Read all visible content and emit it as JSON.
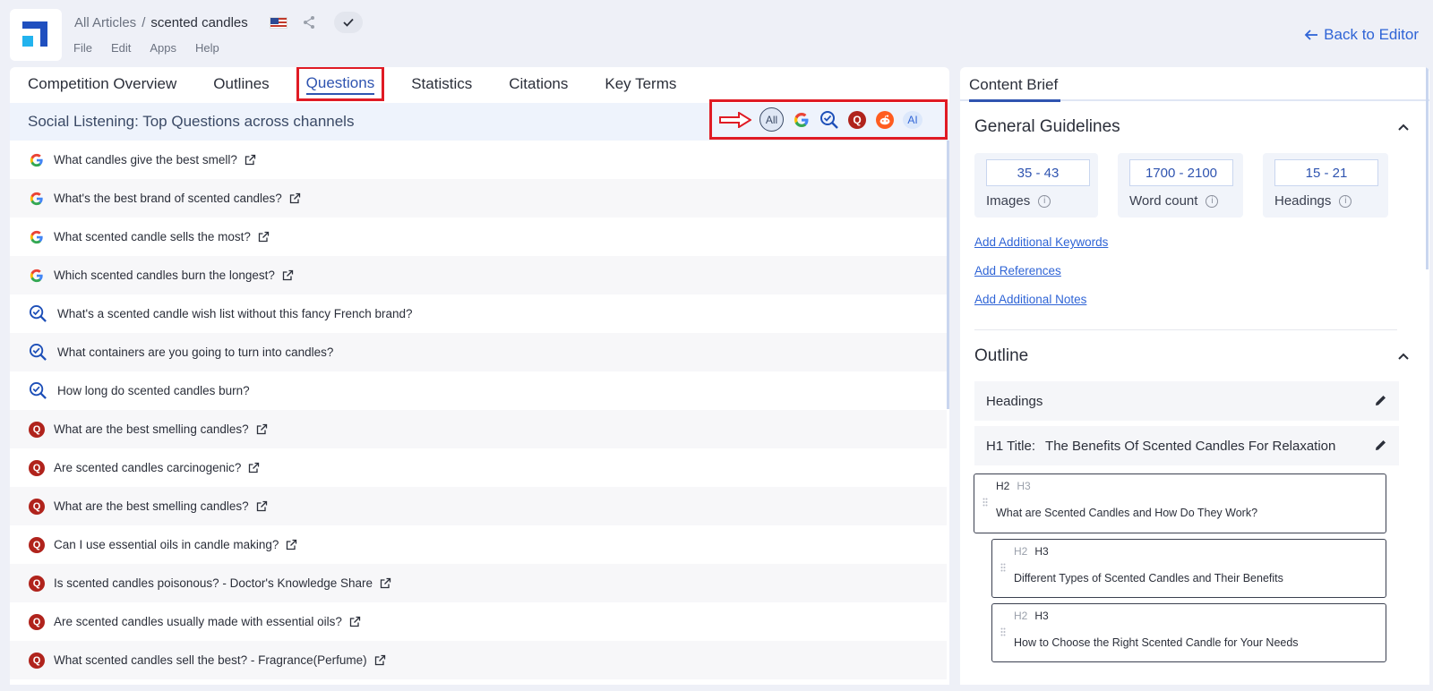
{
  "header": {
    "breadcrumb_root": "All Articles",
    "breadcrumb_sep": "/",
    "breadcrumb_current": "scented candles",
    "menu": [
      "File",
      "Edit",
      "Apps",
      "Help"
    ],
    "back_label": "Back to Editor"
  },
  "tabs": [
    "Competition Overview",
    "Outlines",
    "Questions",
    "Statistics",
    "Citations",
    "Key Terms"
  ],
  "active_tab": "Questions",
  "social": {
    "title": "Social Listening: Top Questions across channels",
    "filter_all": "All",
    "filter_ai": "AI",
    "filter_quora_glyph": "Q"
  },
  "questions": [
    {
      "source": "google",
      "text": "What candles give the best smell?"
    },
    {
      "source": "google",
      "text": "What's the best brand of scented candles?"
    },
    {
      "source": "google",
      "text": "What scented candle sells the most?"
    },
    {
      "source": "google",
      "text": "Which scented candles burn the longest?"
    },
    {
      "source": "search",
      "text": "What's a scented candle wish list without this fancy French brand?"
    },
    {
      "source": "search",
      "text": "What containers are you going to turn into candles?"
    },
    {
      "source": "search",
      "text": "How long do scented candles burn?"
    },
    {
      "source": "quora",
      "text": "What are the best smelling candles?"
    },
    {
      "source": "quora",
      "text": "Are scented candles carcinogenic?"
    },
    {
      "source": "quora",
      "text": "What are the best smelling candles?"
    },
    {
      "source": "quora",
      "text": "Can I use essential oils in candle making?"
    },
    {
      "source": "quora",
      "text": "Is scented candles poisonous? - Doctor's Knowledge Share"
    },
    {
      "source": "quora",
      "text": "Are scented candles usually made with essential oils?"
    },
    {
      "source": "quora",
      "text": "What scented candles sell the best? - Fragrance(Perfume)"
    }
  ],
  "brief": {
    "tab_label": "Content Brief",
    "guidelines_title": "General Guidelines",
    "stats": [
      {
        "value": "35 - 43",
        "label": "Images"
      },
      {
        "value": "1700 - 2100",
        "label": "Word count"
      },
      {
        "value": "15 - 21",
        "label": "Headings"
      }
    ],
    "info_glyph": "i",
    "links": [
      "Add Additional Keywords",
      "Add References",
      "Add Additional Notes"
    ],
    "outline_title": "Outline",
    "headings_label": "Headings",
    "h1_label": "H1 Title:",
    "h1_value": "The Benefits Of Scented Candles For Relaxation",
    "h2_tag": "H2",
    "h3_tag": "H3",
    "cards": [
      {
        "level": "H2",
        "text": "What are Scented Candles and How Do They Work?"
      },
      {
        "level": "H3",
        "text": "Different Types of Scented Candles and Their Benefits"
      },
      {
        "level": "H3",
        "text": "How to Choose the Right Scented Candle for Your Needs"
      }
    ]
  },
  "colors": {
    "accent": "#2f54b0",
    "link": "#2f64d6",
    "highlight": "#e01b24",
    "quora": "#b0231c",
    "reddit": "#ff5c1f"
  }
}
